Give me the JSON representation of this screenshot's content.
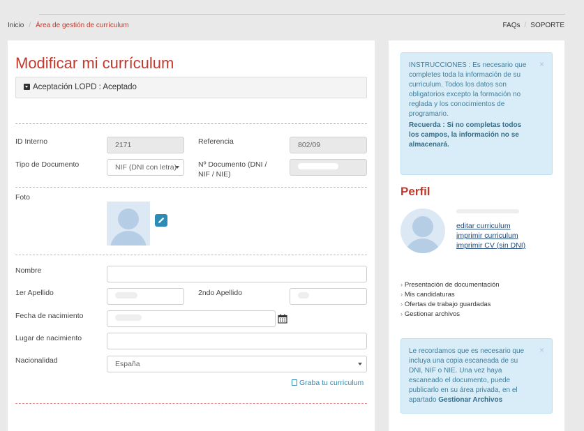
{
  "breadcrumb": {
    "home": "Inicio",
    "current": "Área de gestión de currículum"
  },
  "top_links": {
    "faqs": "FAQs",
    "support": "SOPORTE"
  },
  "main": {
    "title": "Modificar mi currículum",
    "lopd": "Aceptación LOPD : Aceptado",
    "id_label": "ID Interno",
    "id_value": "2171",
    "ref_label": "Referencia",
    "ref_value": "802/09",
    "doc_type_label": "Tipo de Documento",
    "doc_type_value": "NIF (DNI con letra)",
    "doc_number_label": "Nº Documento (DNI / NIF / NIE)",
    "photo_label": "Foto",
    "name_label": "Nombre",
    "surname1_label": "1er Apellido",
    "surname2_label": "2ndo Apellido",
    "birthdate_label": "Fecha de nacimiento",
    "birthplace_label": "Lugar de nacimiento",
    "nationality_label": "Nacionalidad",
    "nationality_value": "España",
    "save_link": "Graba tu curriculum"
  },
  "sidebar": {
    "instructions_text": "INSTRUCCIONES : Es necesario que completes toda la información de su curriculum. Todos los datos son obligatorios excepto la formación no reglada y los conocimientos de programario.",
    "instructions_strong": "Recuerda : Si no completas todos los campos, la información no se almacenará.",
    "close_glyph": "×",
    "profile_title": "Perfil",
    "profile_links": [
      "editar curriculum",
      "imprimir curriculum",
      "imprimir CV (sin DNI)"
    ],
    "menu": [
      "Presentación de documentación",
      "Mis candidaturas",
      "Ofertas de trabajo guardadas",
      "Gestionar archivos"
    ],
    "note_text": "Le recordamos que es necesario que incluya una copia escaneada de su DNI, NIF o NIE. Una vez haya escaneado el documento, puede publicarlo en su área privada, en el apartado",
    "note_strong": "Gestionar Archivos"
  },
  "colors": {
    "accent": "#c0392b",
    "info_bg": "#d8edf7",
    "info_text": "#3d7f9f",
    "link": "#2c8bb7"
  },
  "icons": [
    "caret-down-icon",
    "edit-icon",
    "calendar-icon",
    "save-icon",
    "close-icon",
    "avatar-icon"
  ]
}
